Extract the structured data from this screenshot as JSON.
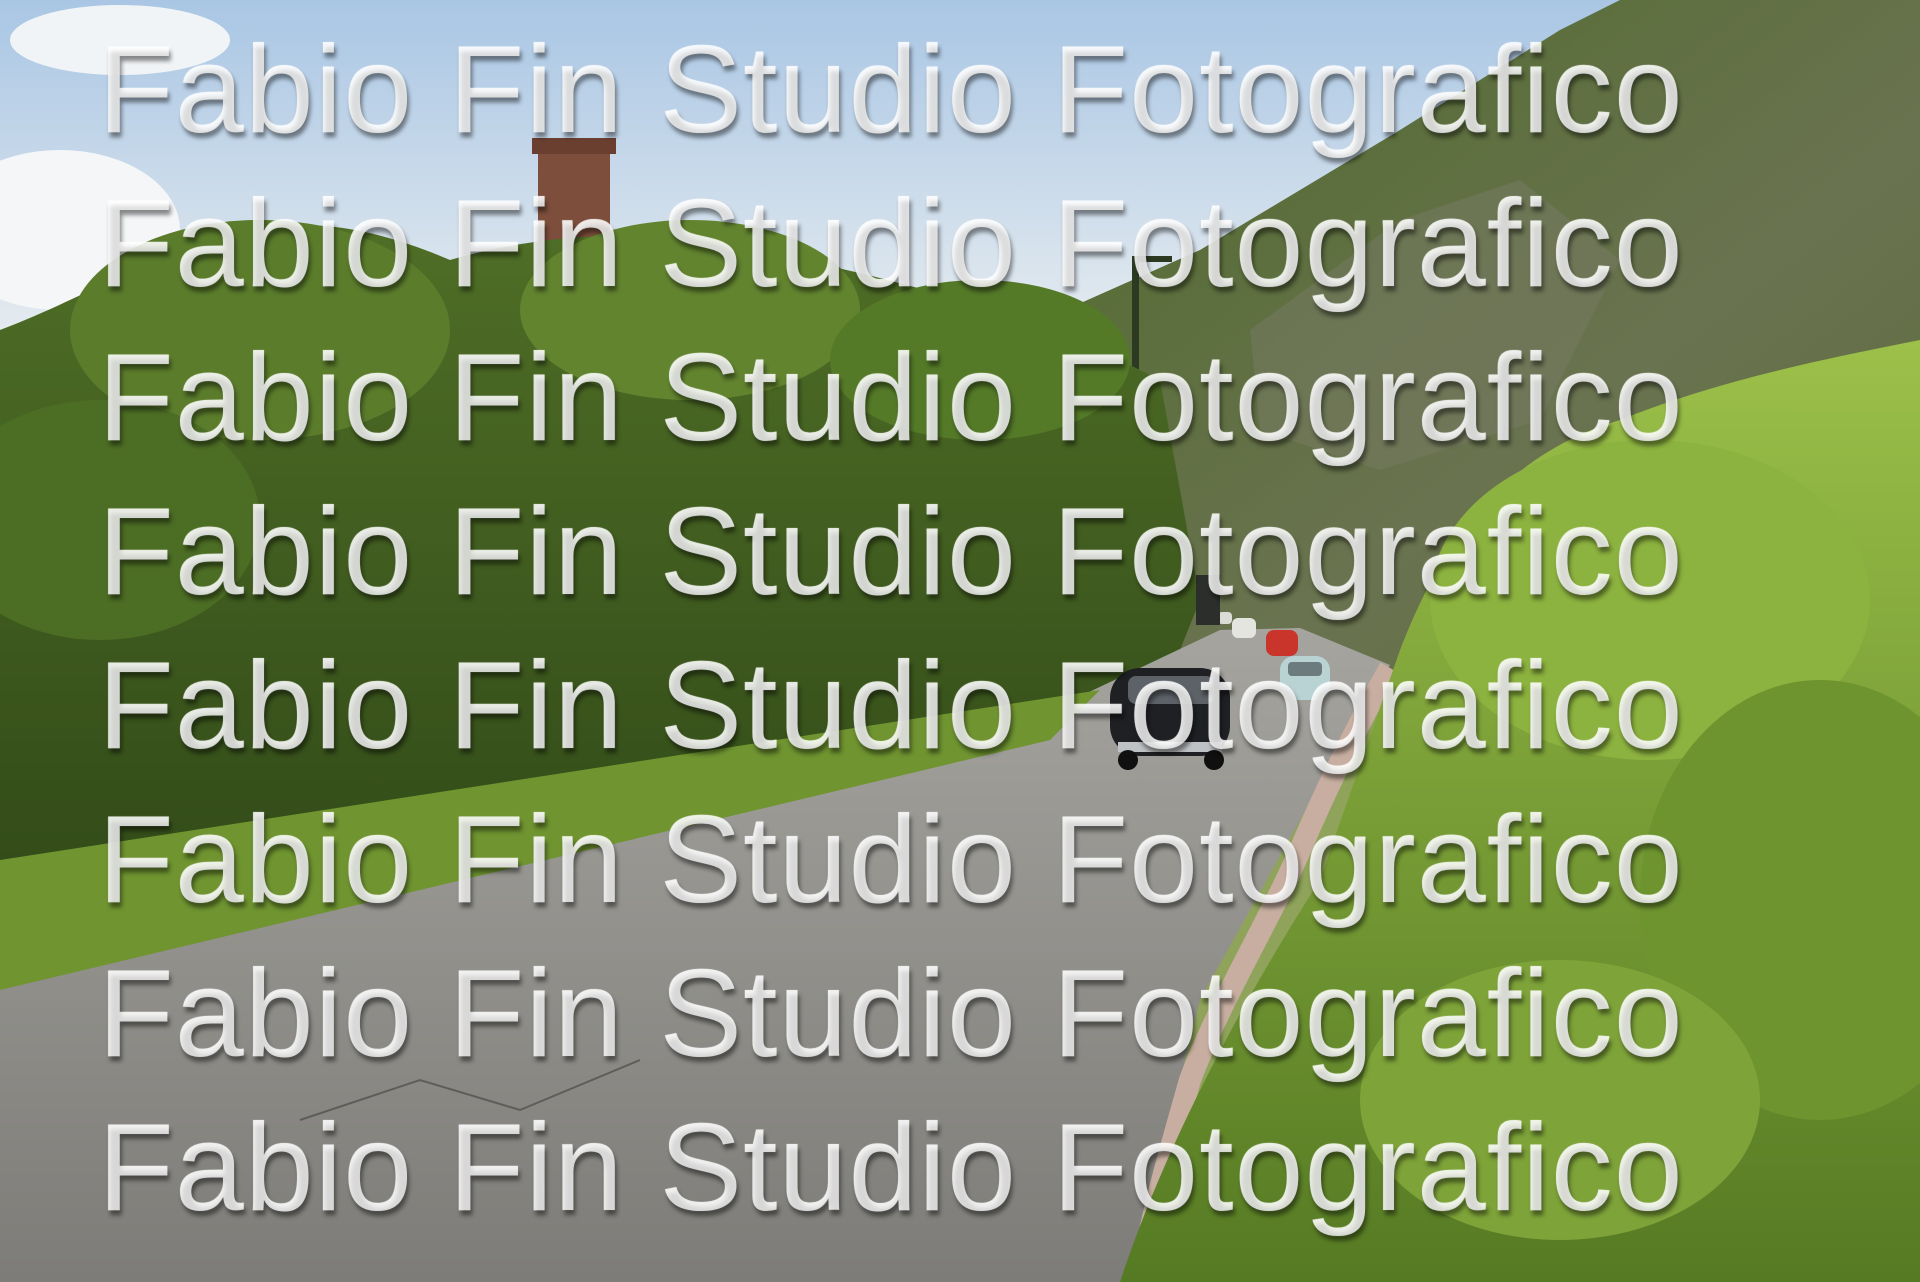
{
  "scene": {
    "description_icon": "photo-landscape-icon",
    "colors": {
      "sky": "#e9eef0",
      "sky_blue": "#9cc0e0",
      "foliage_dark": "#3f5a1f",
      "foliage_light": "#9fc24a",
      "road": "#8c8b88",
      "rock": "#5f6a45",
      "tower": "#7a4b3a"
    }
  },
  "watermark": {
    "text": "Fabio Fin Studio Fotografico",
    "lines": [
      "Fabio Fin Studio Fotografico",
      "Fabio Fin Studio Fotografico",
      "Fabio Fin Studio Fotografico",
      "Fabio Fin Studio Fotografico",
      "Fabio Fin Studio Fotografico",
      "Fabio Fin Studio Fotografico",
      "Fabio Fin Studio Fotografico",
      "Fabio Fin Studio Fotografico"
    ]
  }
}
